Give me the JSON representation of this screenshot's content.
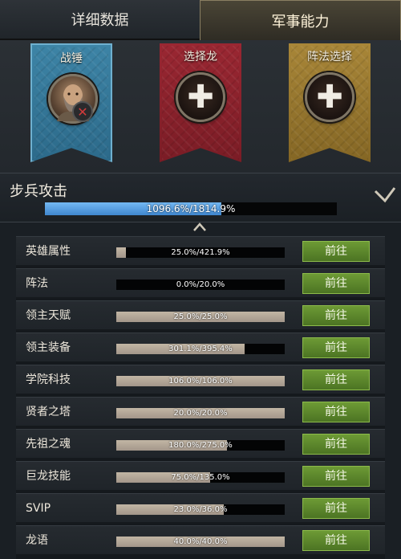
{
  "tabs": [
    {
      "label": "详细数据",
      "active": false
    },
    {
      "label": "军事能力",
      "active": true
    }
  ],
  "banners": [
    {
      "title": "战锤",
      "color": "#2f6f90",
      "emblem": "hero-portrait-icon",
      "has_remove": true
    },
    {
      "title": "选择龙",
      "color": "#8a2230",
      "emblem": "plus-icon"
    },
    {
      "title": "阵法选择",
      "color": "#95752c",
      "emblem": "plus-icon"
    }
  ],
  "icons": {
    "plus": "✚",
    "remove": "✕"
  },
  "attack": {
    "title": "步兵攻击",
    "bar_text": "1096.6%/1814.9%",
    "progress": 0.604
  },
  "rows": [
    {
      "label": "英雄属性",
      "text": "25.0%/421.9%",
      "fill": 0.059,
      "button": "前往"
    },
    {
      "label": "阵法",
      "text": "0.0%/20.0%",
      "fill": 0.0,
      "button": "前往"
    },
    {
      "label": "领主天赋",
      "text": "25.0%/25.0%",
      "fill": 1.0,
      "button": "前往"
    },
    {
      "label": "领主装备",
      "text": "301.1%/395.4%",
      "fill": 0.761,
      "button": "前往"
    },
    {
      "label": "学院科技",
      "text": "106.0%/106.0%",
      "fill": 1.0,
      "button": "前往"
    },
    {
      "label": "贤者之塔",
      "text": "20.0%/20.0%",
      "fill": 1.0,
      "button": "前往"
    },
    {
      "label": "先祖之魂",
      "text": "180.0%/275.0%",
      "fill": 0.655,
      "button": "前往"
    },
    {
      "label": "巨龙技能",
      "text": "75.0%/135.0%",
      "fill": 0.556,
      "button": "前往"
    },
    {
      "label": "SVIP",
      "text": "23.0%/36.0%",
      "fill": 0.639,
      "button": "前往"
    },
    {
      "label": "龙语",
      "text": "40.0%/40.0%",
      "fill": 1.0,
      "button": "前往"
    }
  ],
  "colors": {
    "progress_blue": "#4f97dd",
    "row_fill": "#b3a797",
    "go_button": "#5a8229"
  }
}
